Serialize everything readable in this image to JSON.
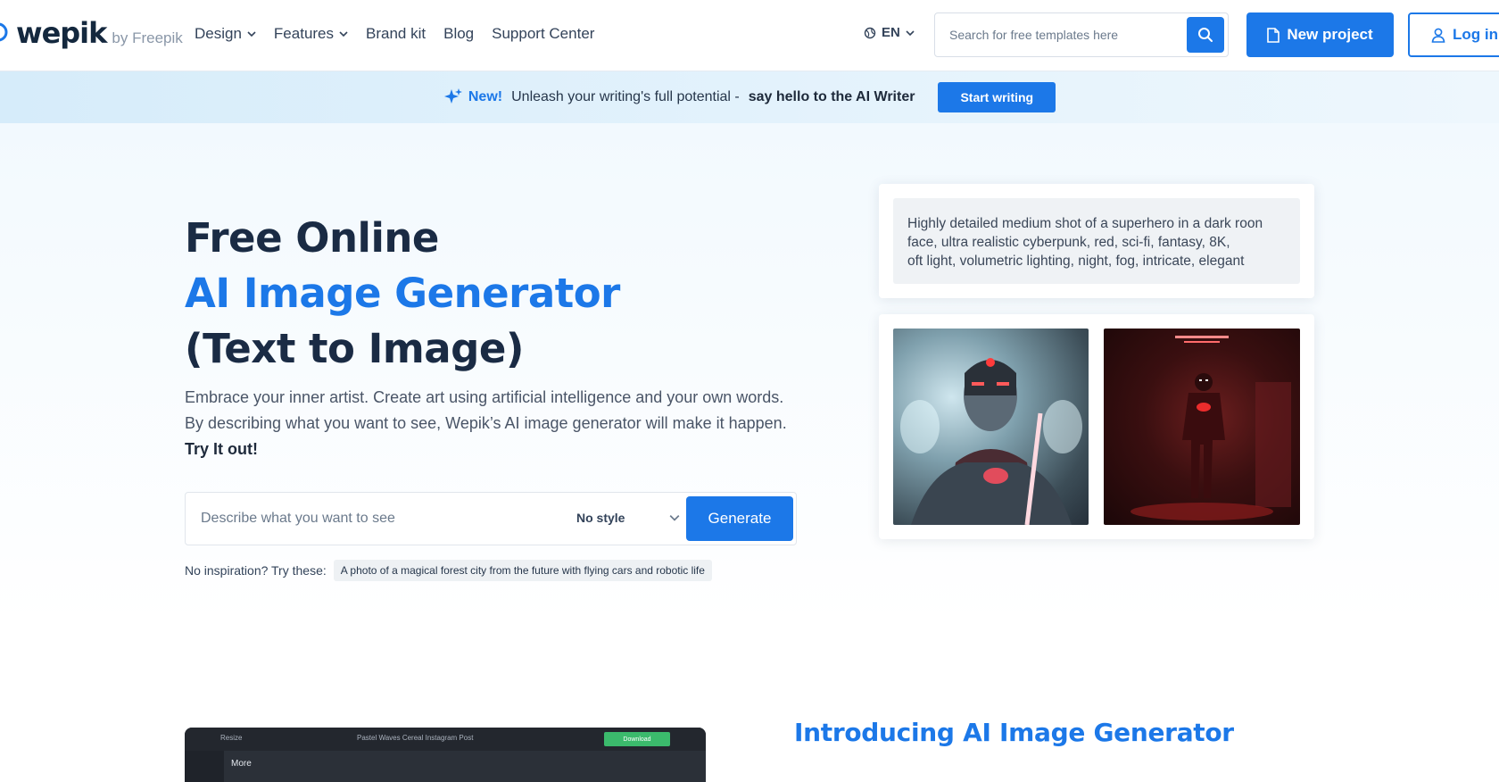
{
  "header": {
    "logo_word": "wepik",
    "logo_by": "by Freepik",
    "nav": [
      {
        "label": "Design",
        "has_dropdown": true
      },
      {
        "label": "Features",
        "has_dropdown": true
      },
      {
        "label": "Brand kit",
        "has_dropdown": false
      },
      {
        "label": "Blog",
        "has_dropdown": false
      },
      {
        "label": "Support Center",
        "has_dropdown": false
      }
    ],
    "language": "EN",
    "search_placeholder": "Search for free templates here",
    "new_project_label": "New project",
    "login_label": "Log in"
  },
  "banner": {
    "new_label": "New!",
    "text": "Unleash your writing's full potential -",
    "strong_text": "say hello to the AI Writer",
    "button_label": "Start writing"
  },
  "hero": {
    "title_line1": "Free Online",
    "title_line2": "AI Image Generator",
    "title_line3": "(Text to Image)",
    "description": "Embrace your inner artist. Create art using artificial intelligence and your own words. By describing what you want to see, Wepik’s AI image generator will make it happen.",
    "description_cta": "Try It out!",
    "input_placeholder": "Describe what you want to see",
    "style_value": "No style",
    "generate_label": "Generate",
    "inspire_label": "No inspiration? Try these:",
    "inspire_chip": "A photo of a magical forest city from the future with flying cars and robotic life"
  },
  "showcase": {
    "prompt_line1": "Highly detailed medium shot of a superhero in a dark roon",
    "prompt_line2": "face, ultra realistic cyberpunk, red, sci-fi, fantasy, 8K,",
    "prompt_line3": "oft light, volumetric lighting, night, fog, intricate, elegant"
  },
  "lower": {
    "editor_title": "Pastel Waves Cereal Instagram Post",
    "editor_resize": "Resize",
    "editor_download": "Download",
    "editor_more": "More",
    "intro_title": "Introducing AI Image Generator"
  },
  "colors": {
    "brand_blue": "#1c78e8",
    "heading_dark": "#1a2b44",
    "banner_bg": "#d6ecfa"
  }
}
